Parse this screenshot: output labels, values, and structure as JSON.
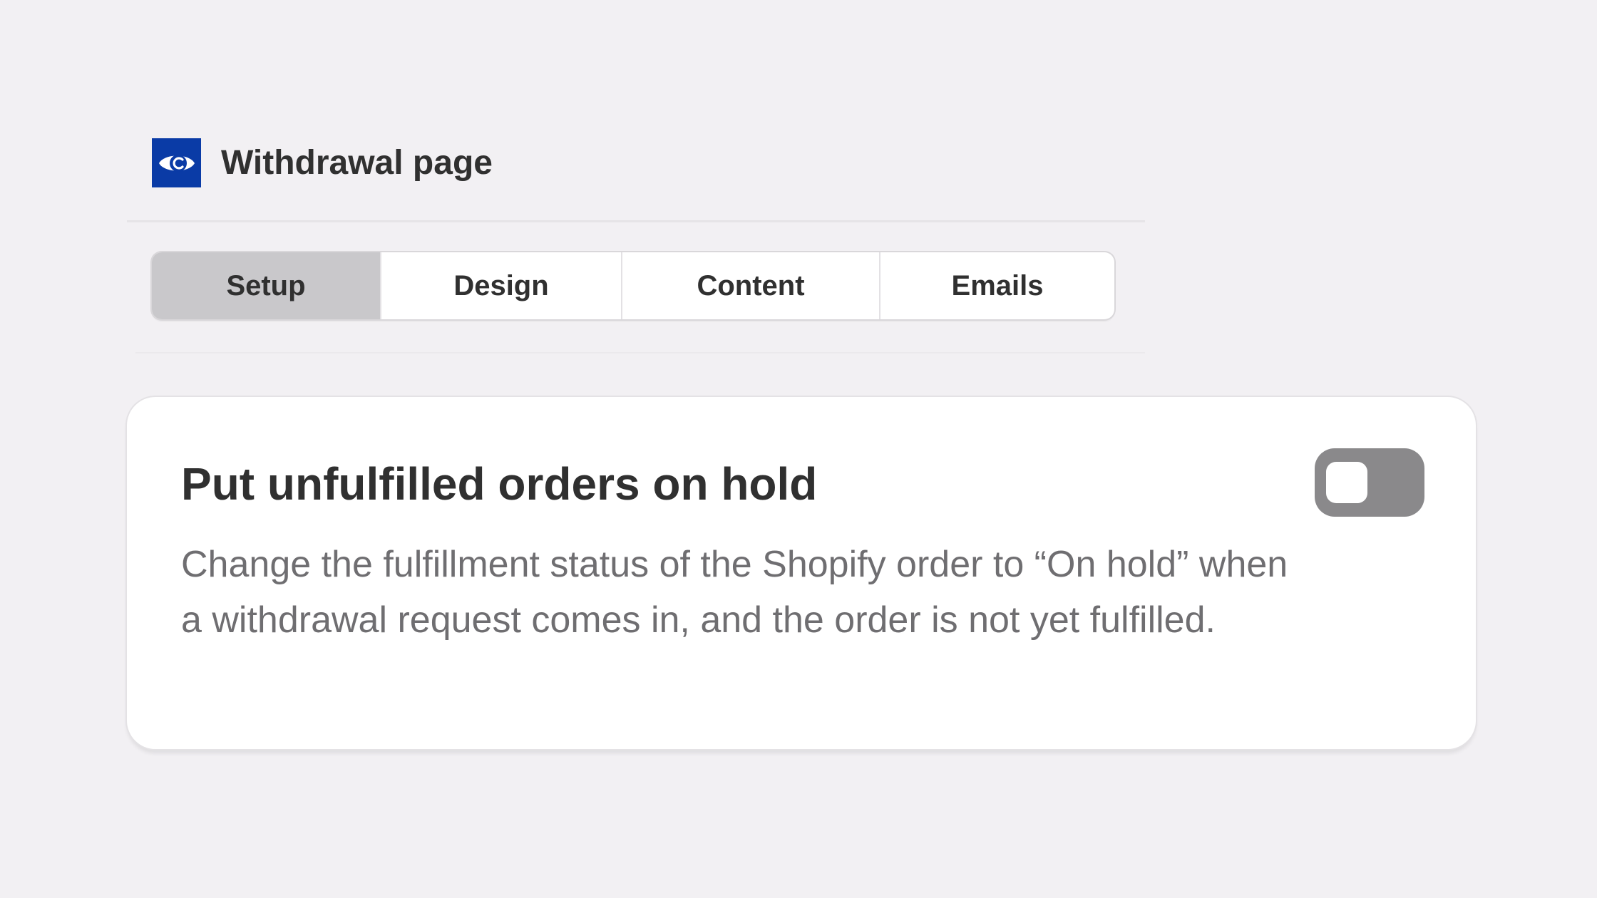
{
  "app": {
    "title": "Withdrawal page",
    "logo_icon": "eye-c-logo-icon",
    "logo_color": "#0a3ba6"
  },
  "tabs": [
    {
      "label": "Setup",
      "active": true
    },
    {
      "label": "Design",
      "active": false
    },
    {
      "label": "Content",
      "active": false
    },
    {
      "label": "Emails",
      "active": false
    }
  ],
  "setting": {
    "title": "Put unfulfilled orders on hold",
    "description": "Change the fulfillment status of the Shopify order to “On hold” when a withdrawal request comes in, and the order is not yet fulfilled.",
    "toggle_on": false
  }
}
